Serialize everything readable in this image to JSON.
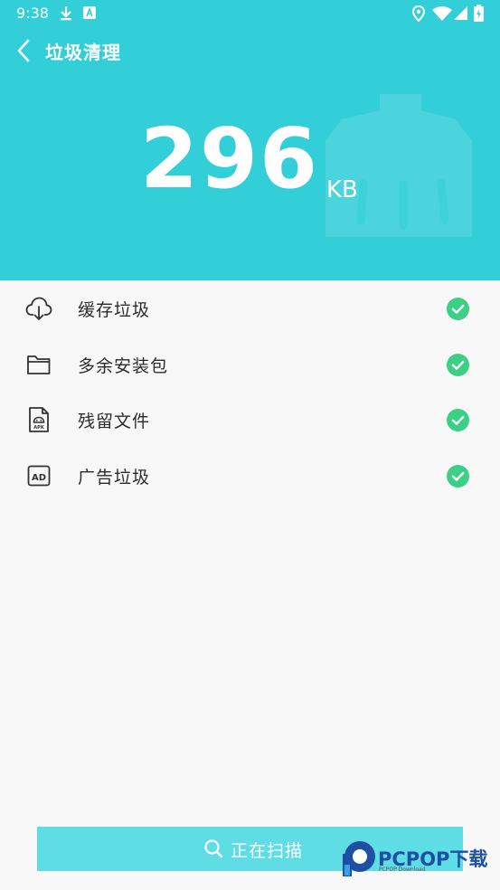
{
  "status_bar": {
    "time": "9:38"
  },
  "header": {
    "title": "垃圾清理",
    "size_value": "296",
    "size_unit": "KB"
  },
  "items": [
    {
      "label": "缓存垃圾",
      "icon": "cloud-download-icon"
    },
    {
      "label": "多余安装包",
      "icon": "folder-icon"
    },
    {
      "label": "残留文件",
      "icon": "apk-file-icon"
    },
    {
      "label": "广告垃圾",
      "icon": "ad-icon"
    }
  ],
  "scan_button": {
    "label": "正在扫描"
  },
  "watermark": {
    "brand": "PCPOP下载",
    "sub": "PCPOP Download"
  },
  "colors": {
    "header_bg": "#33cfd9",
    "check_green": "#3ccf86",
    "button_bg": "#5fdde4"
  }
}
